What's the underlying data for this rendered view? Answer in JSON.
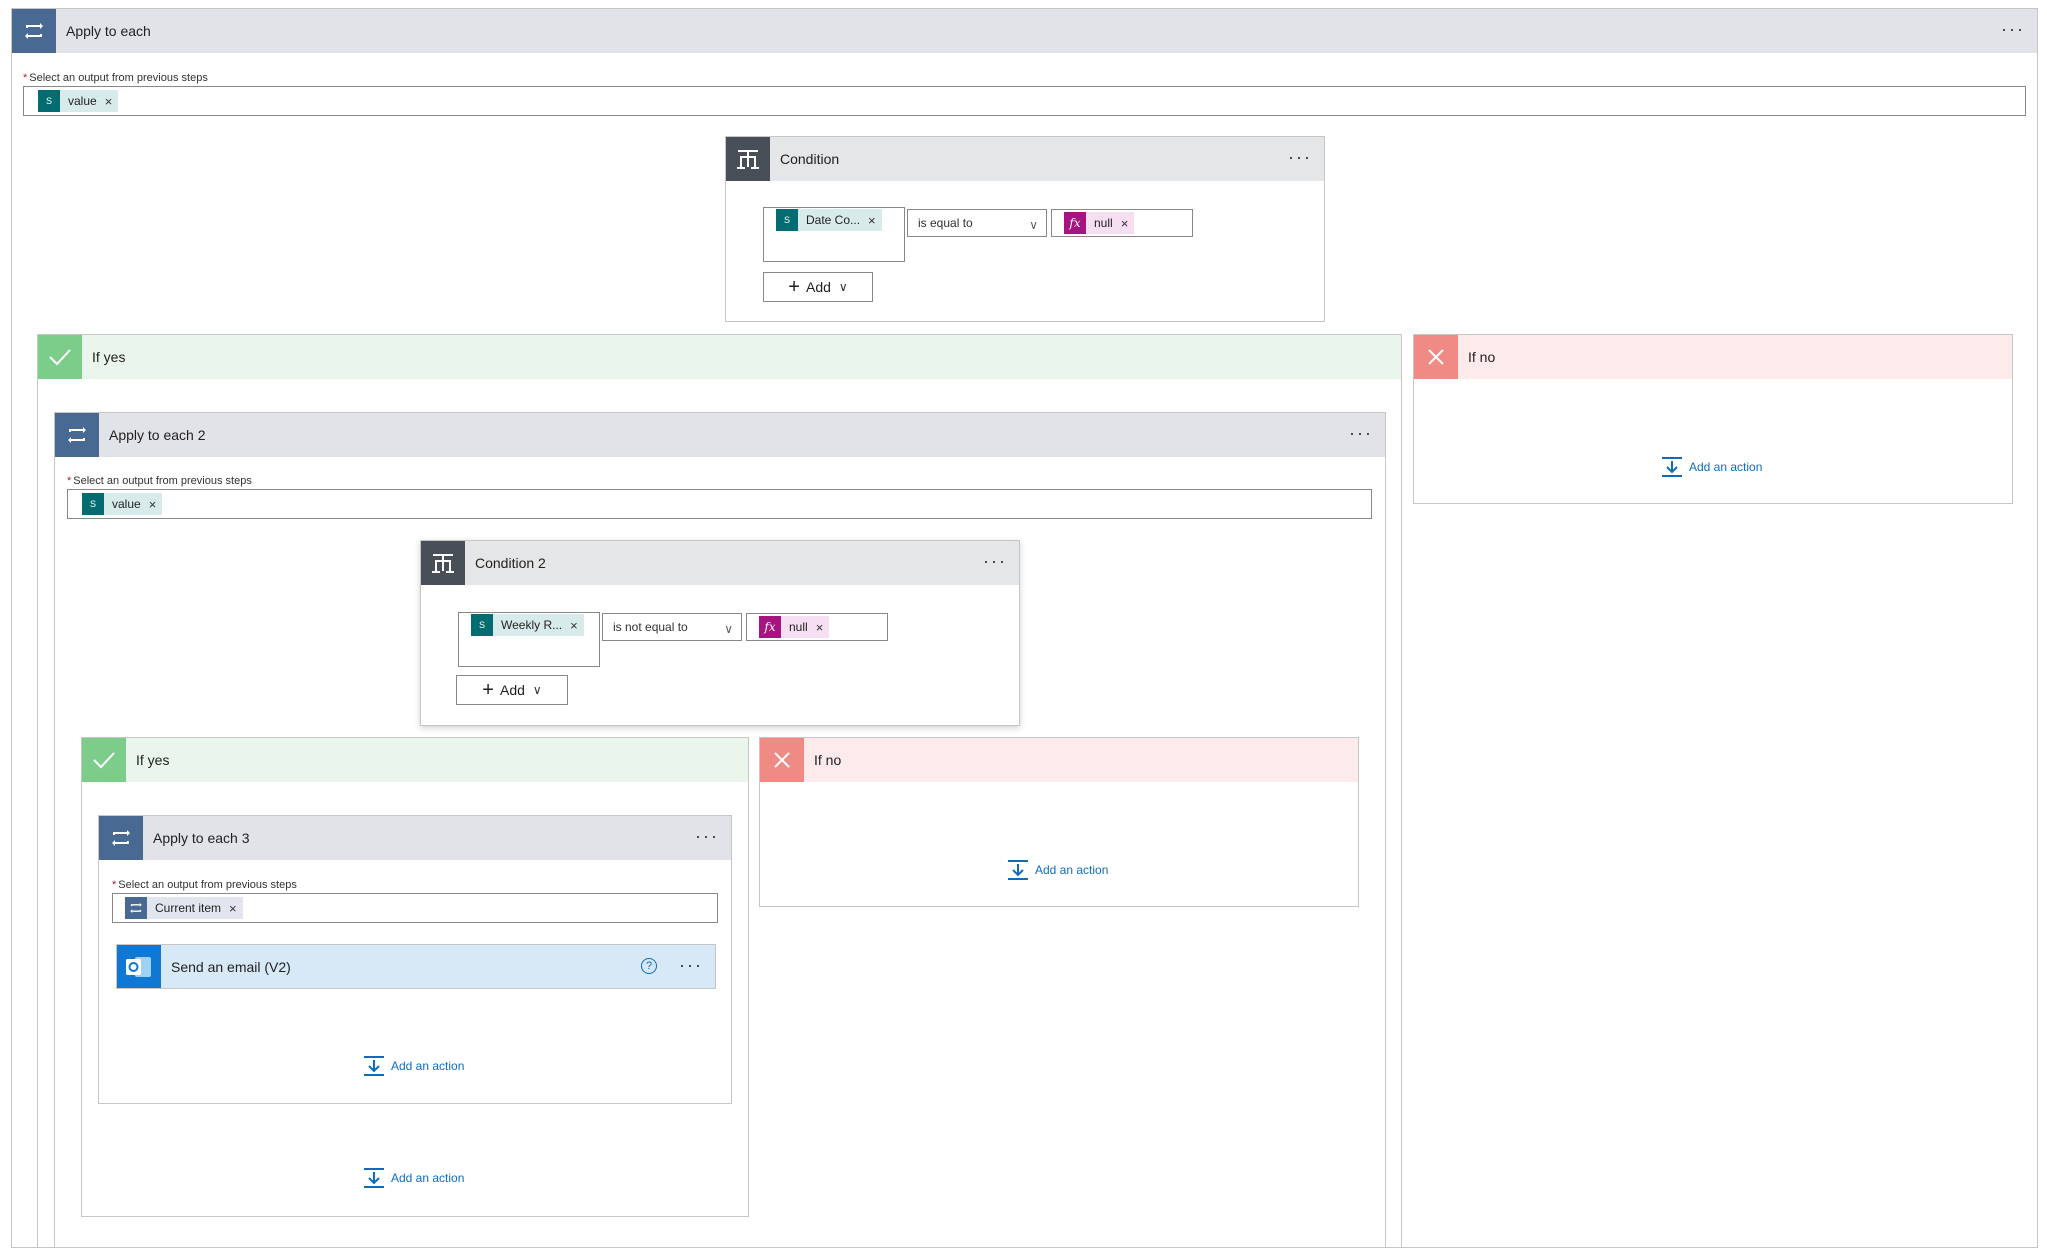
{
  "common": {
    "select_label": "Select an output from previous steps",
    "required_mark": "*",
    "add_action": "Add an action",
    "add_button": "Add",
    "more": "···"
  },
  "apply1": {
    "title": "Apply to each",
    "token": "value"
  },
  "condition1": {
    "title": "Condition",
    "left_token": "Date Co...",
    "operator": "is equal to",
    "right_token": "null"
  },
  "yes1": {
    "title": "If yes"
  },
  "no1": {
    "title": "If no"
  },
  "apply2": {
    "title": "Apply to each 2",
    "token": "value"
  },
  "condition2": {
    "title": "Condition 2",
    "left_token": "Weekly R...",
    "operator": "is not equal to",
    "right_token": "null"
  },
  "yes2": {
    "title": "If yes"
  },
  "no2": {
    "title": "If no"
  },
  "apply3": {
    "title": "Apply to each 3",
    "token": "Current item"
  },
  "email": {
    "title": "Send an email (V2)",
    "help": "?"
  },
  "colors": {
    "loop": "#486991",
    "condition": "#484f58",
    "yes": "#7dcd8a",
    "no": "#f08a85",
    "sharepoint": "#036c70",
    "expression": "#a5147f",
    "outlook": "#0f78d4",
    "link": "#0f6cbd"
  },
  "icons": [
    "loop-icon",
    "condition-icon",
    "check-icon",
    "close-icon",
    "sharepoint-icon",
    "fx-icon",
    "outlook-icon",
    "add-action-icon",
    "help-icon",
    "token-remove-icon"
  ]
}
